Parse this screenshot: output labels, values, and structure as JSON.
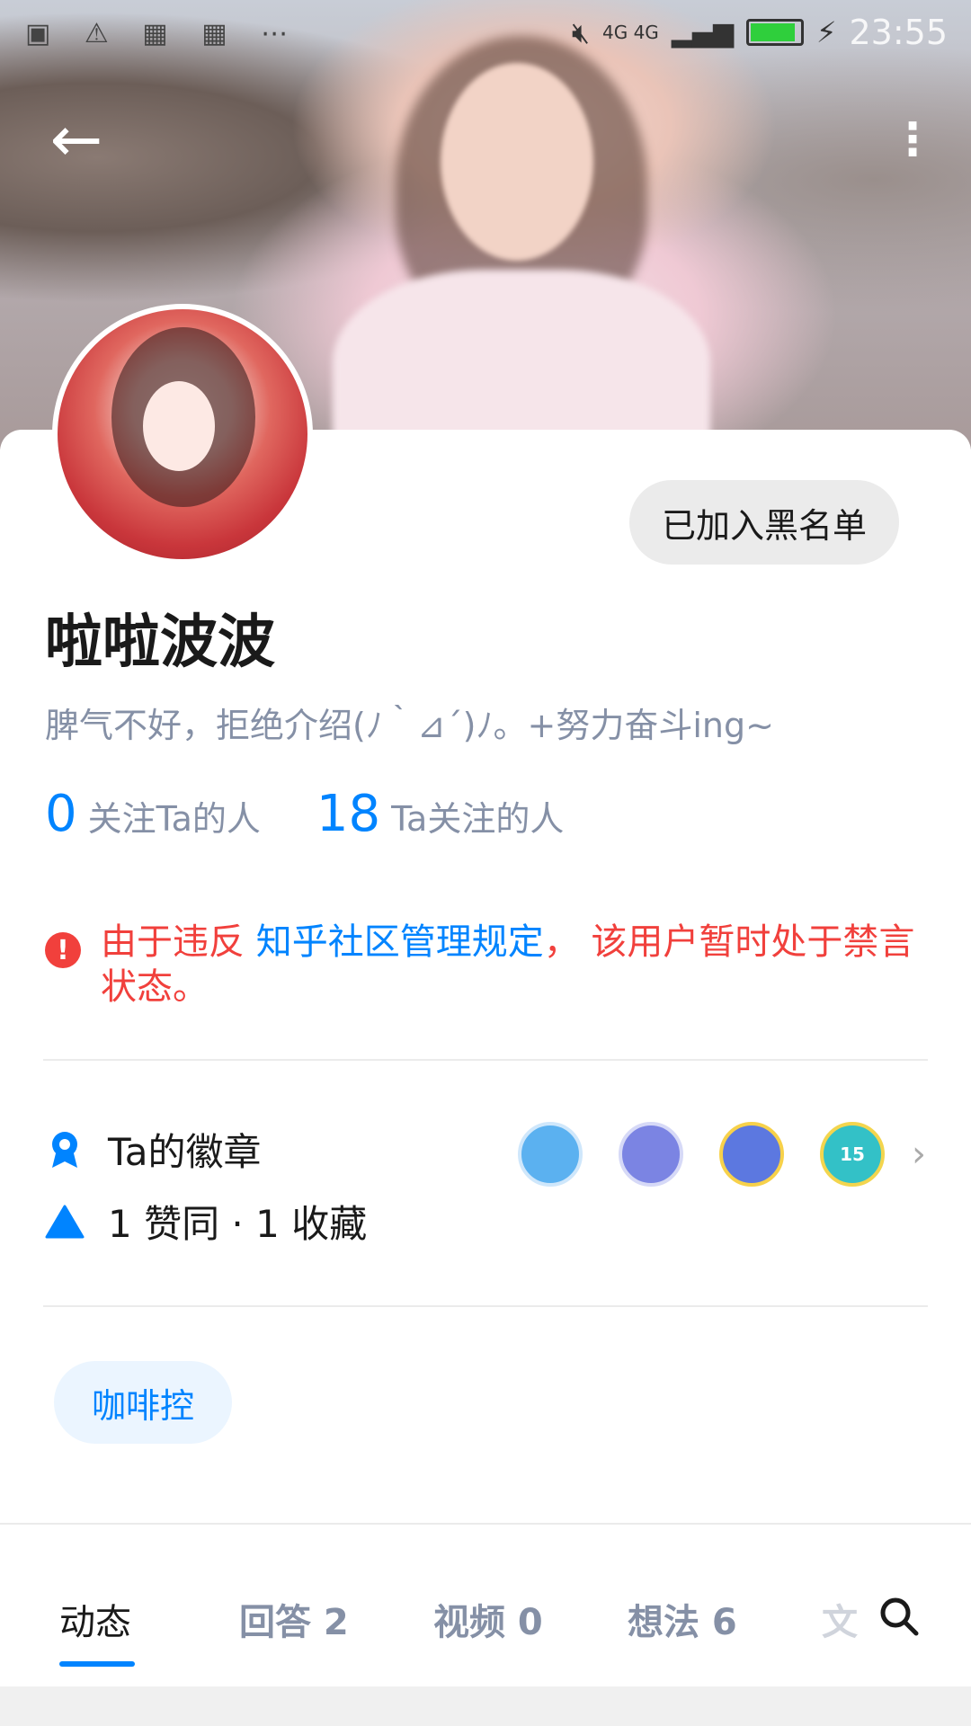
{
  "status_bar": {
    "left_icons": "▣ ⚠ ▦ ▦ ⋯",
    "network": "4G 4G",
    "time": "23:55"
  },
  "header": {
    "back_icon": "←",
    "more_icon": "⋮"
  },
  "profile": {
    "blacklist_button": "已加入黑名单",
    "name": "啦啦波波",
    "bio": "脾气不好，拒绝介绍(ﾉ｀⊿´)ﾉ。+努力奋斗ing~",
    "followers_count": "0",
    "followers_label": "关注Ta的人",
    "following_count": "18",
    "following_label": "Ta关注的人"
  },
  "notice": {
    "icon": "!",
    "text_before": "由于违反 ",
    "link": "知乎社区管理规定",
    "text_after": "， 该用户暂时处于禁言状态。"
  },
  "badges_row": {
    "label": "Ta的徽章",
    "badge_15": "15",
    "chevron": "›"
  },
  "stats_row": {
    "text": "1 赞同 · 1 收藏"
  },
  "tag": {
    "label": "咖啡控"
  },
  "tabs": [
    {
      "label": "动态"
    },
    {
      "label": "回答 2"
    },
    {
      "label": "视频 0"
    },
    {
      "label": "想法 6"
    },
    {
      "label": "文"
    }
  ],
  "colors": {
    "accent": "#0084ff",
    "warning": "#f1403c",
    "muted": "#8590a6"
  }
}
